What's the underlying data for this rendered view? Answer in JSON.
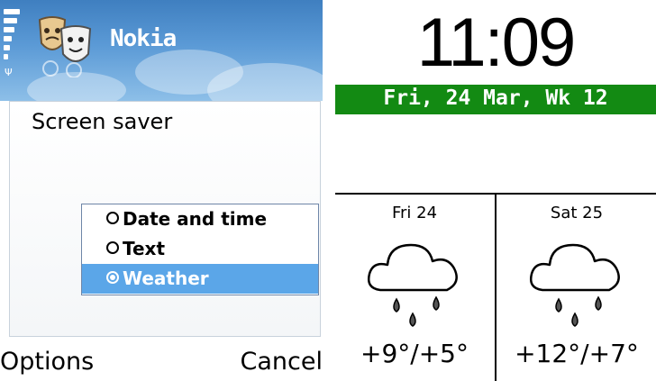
{
  "phone": {
    "app_title": "Nokia",
    "screen_title": "Screen saver",
    "options": [
      {
        "label": "Date and time",
        "selected": false
      },
      {
        "label": "Text",
        "selected": false
      },
      {
        "label": "Weather",
        "selected": true
      }
    ],
    "softkeys": {
      "left": "Options",
      "right": "Cancel"
    },
    "icons": [
      "signal-strength-icon",
      "antenna-icon",
      "themes-masks-icon",
      "radio-icon"
    ],
    "colors": {
      "title_bar": "#4f8dcc",
      "selection": "#5ba6e8"
    }
  },
  "clock": {
    "time": "11:09",
    "date": "Fri, 24 Mar, Wk 12",
    "colors": {
      "date_bar": "#138a13"
    },
    "forecast": [
      {
        "day": "Fri 24",
        "icon": "rain-cloud-icon",
        "temp": "+9°/+5°"
      },
      {
        "day": "Sat 25",
        "icon": "rain-cloud-icon",
        "temp": "+12°/+7°"
      }
    ]
  }
}
